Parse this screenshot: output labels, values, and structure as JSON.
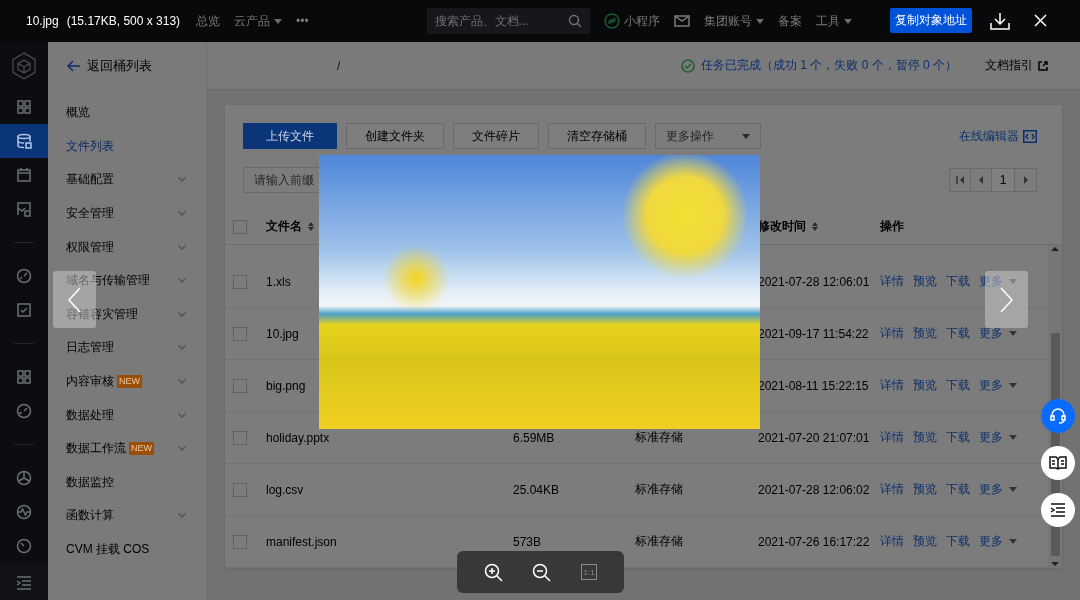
{
  "viewer": {
    "file_name": "10.jpg",
    "file_info": "(15.17KB, 500 x 313)",
    "copy_button": "复制对象地址",
    "actual_size": "1:1"
  },
  "top_nav": {
    "items": [
      {
        "label": "总览",
        "kind": "link"
      },
      {
        "label": "云产品",
        "kind": "menu"
      },
      {
        "label": "•••",
        "kind": "link"
      }
    ],
    "search": {
      "placeholder": "搜索产品、文档..."
    },
    "right_items": [
      {
        "label": "小程序",
        "kind": "miniapp"
      },
      {
        "kind": "mail"
      },
      {
        "label": "集团账号",
        "kind": "menu"
      },
      {
        "label": "备案",
        "kind": "link"
      },
      {
        "label": "工具",
        "kind": "menu"
      }
    ]
  },
  "rail": {
    "groups": [
      [
        {
          "selected": false
        },
        {
          "selected": true
        },
        {
          "selected": false
        },
        {
          "selected": false
        }
      ],
      [
        {
          "selected": false
        },
        {
          "selected": false
        }
      ],
      [
        {
          "selected": false
        },
        {
          "selected": false
        }
      ],
      [
        {
          "selected": false
        },
        {
          "selected": false
        },
        {
          "selected": false
        }
      ]
    ]
  },
  "sidebar": {
    "back_label": "返回桶列表",
    "items": [
      {
        "label": "概览",
        "selected": false,
        "expandable": false
      },
      {
        "label": "文件列表",
        "selected": true,
        "expandable": false
      },
      {
        "label": "基础配置",
        "selected": false,
        "expandable": true
      },
      {
        "label": "安全管理",
        "selected": false,
        "expandable": true
      },
      {
        "label": "权限管理",
        "selected": false,
        "expandable": true
      },
      {
        "label": "域名与传输管理",
        "selected": false,
        "expandable": true
      },
      {
        "label": "容错容灾管理",
        "selected": false,
        "expandable": true
      },
      {
        "label": "日志管理",
        "selected": false,
        "expandable": true
      },
      {
        "label": "内容审核",
        "badge": "NEW",
        "selected": false,
        "expandable": true
      },
      {
        "label": "数据处理",
        "selected": false,
        "expandable": true
      },
      {
        "label": "数据工作流",
        "badge": "NEW",
        "selected": false,
        "expandable": true
      },
      {
        "label": "数据监控",
        "selected": false,
        "expandable": false
      },
      {
        "label": "函数计算",
        "selected": false,
        "expandable": true
      },
      {
        "label": "CVM 挂载 COS",
        "selected": false,
        "expandable": false
      }
    ]
  },
  "header": {
    "breadcrumb": "/",
    "task_status": "任务已完成（成功 1 个，失败 0 个，暂停 0 个）",
    "docs_link": "文档指引"
  },
  "toolbar": {
    "buttons": [
      {
        "label": "上传文件",
        "kind": "primary"
      },
      {
        "label": "创建文件夹",
        "kind": "default"
      },
      {
        "label": "文件碎片",
        "kind": "default"
      },
      {
        "label": "清空存储桶",
        "kind": "default"
      }
    ],
    "more_select": {
      "placeholder": "更多操作"
    },
    "editor_link": "在线编辑器"
  },
  "file_search": {
    "placeholder": "请输入前缀"
  },
  "pager": {
    "current_page": "1"
  },
  "table": {
    "header_checked": false,
    "columns": [
      {
        "label": "文件名",
        "sortable": true
      },
      {
        "label": "修改时间",
        "sortable": true
      },
      {
        "label": "操作",
        "sortable": false
      }
    ],
    "rows": [
      {
        "checked": false,
        "name": "1.xls",
        "modified": "2021-07-28 12:06:01",
        "actions": [
          "详情",
          "预览",
          "下载",
          "更多"
        ]
      },
      {
        "checked": false,
        "name": "10.jpg",
        "modified": "2021-09-17 11:54:22",
        "actions": [
          "详情",
          "预览",
          "下载",
          "更多"
        ]
      },
      {
        "checked": false,
        "name": "big.png",
        "modified": "2021-08-11 15:22:15",
        "actions": [
          "详情",
          "预览",
          "下载",
          "更多"
        ]
      },
      {
        "checked": false,
        "name": "holiday.pptx",
        "size": "6.59MB",
        "storage": "标准存储",
        "modified": "2021-07-20 21:07:01",
        "actions": [
          "详情",
          "预览",
          "下载",
          "更多"
        ]
      },
      {
        "checked": false,
        "name": "log.csv",
        "size": "25.04KB",
        "storage": "标准存储",
        "modified": "2021-07-28 12:06:02",
        "actions": [
          "详情",
          "预览",
          "下载",
          "更多"
        ]
      },
      {
        "checked": false,
        "name": "manifest.json",
        "size": "573B",
        "storage": "标准存储",
        "modified": "2021-07-26 16:17:22",
        "actions": [
          "详情",
          "预览",
          "下载",
          "更多"
        ]
      }
    ]
  },
  "float_buttons": [
    {
      "kind": "support"
    },
    {
      "kind": "docs"
    },
    {
      "kind": "outline"
    }
  ]
}
